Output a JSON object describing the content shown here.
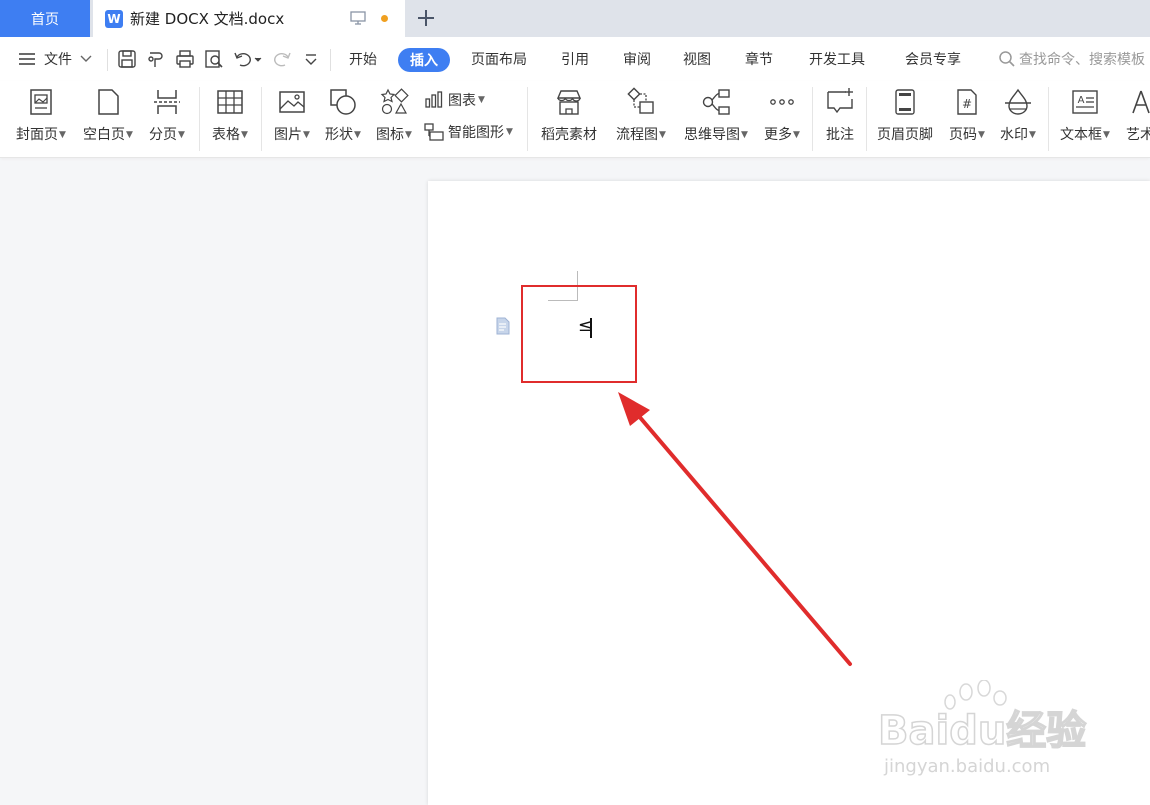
{
  "tabs": {
    "home": "首页",
    "document": "新建 DOCX 文档.docx"
  },
  "menu": {
    "file": "文件",
    "items": [
      {
        "label": "开始"
      },
      {
        "label": "插入",
        "active": true
      },
      {
        "label": "页面布局"
      },
      {
        "label": "引用"
      },
      {
        "label": "审阅"
      },
      {
        "label": "视图"
      },
      {
        "label": "章节"
      },
      {
        "label": "开发工具"
      },
      {
        "label": "会员专享"
      }
    ],
    "search": "查找命令、搜索模板"
  },
  "ribbon": {
    "cover": "封面页",
    "blank": "空白页",
    "pagebreak": "分页",
    "table": "表格",
    "picture": "图片",
    "shape": "形状",
    "icons": "图标",
    "chart": "图表",
    "smartart": "智能图形",
    "material": "稻壳素材",
    "flowchart": "流程图",
    "mindmap": "思维导图",
    "more": "更多",
    "comment": "批注",
    "header_footer": "页眉页脚",
    "page_number": "页码",
    "watermark": "水印",
    "textbox": "文本框",
    "art": "艺术"
  },
  "document": {
    "content": "≤"
  },
  "watermark": {
    "brand": "Baidu经验",
    "url": "jingyan.baidu.com"
  },
  "colors": {
    "accent": "#3e7ef2",
    "highlight": "#e02c2c"
  }
}
